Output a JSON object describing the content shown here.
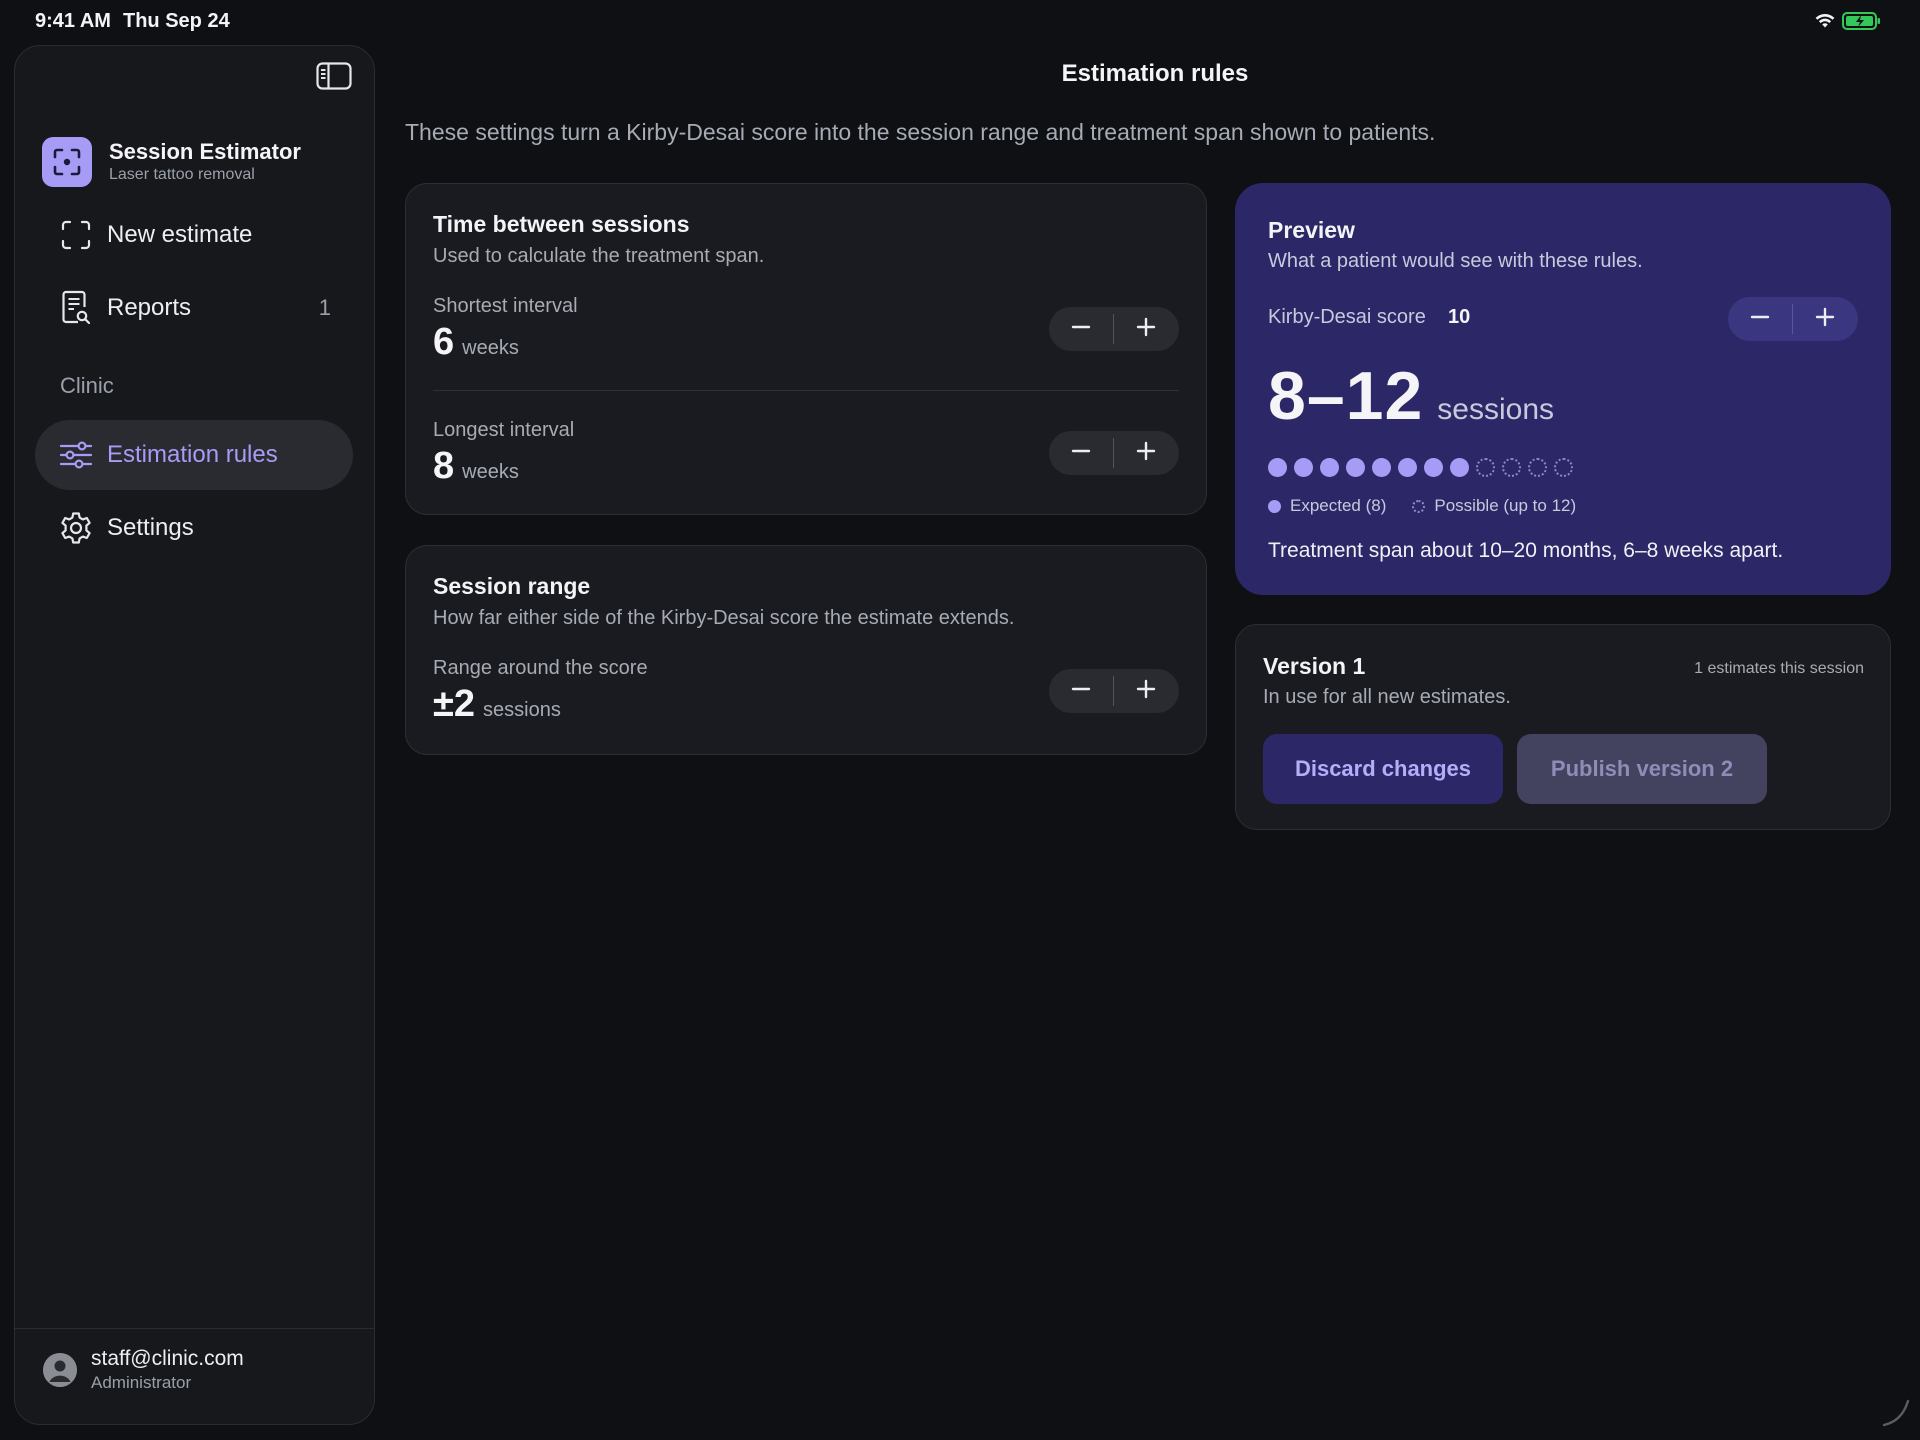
{
  "status_bar": {
    "time": "9:41 AM",
    "date": "Thu Sep 24"
  },
  "app": {
    "name": "Session Estimator",
    "subtitle": "Laser tattoo removal"
  },
  "sidebar": {
    "items": [
      {
        "label": "New estimate",
        "icon": "scan-icon"
      },
      {
        "label": "Reports",
        "icon": "report-search-icon",
        "count": "1"
      }
    ],
    "section_label": "Clinic",
    "section_items": [
      {
        "label": "Estimation rules",
        "icon": "sliders-icon",
        "active": true
      },
      {
        "label": "Settings",
        "icon": "gear-icon"
      }
    ],
    "account": {
      "email": "staff@clinic.com",
      "role": "Administrator"
    }
  },
  "page": {
    "title": "Estimation rules",
    "description": "These settings turn a Kirby-Desai score into the session range and treatment span shown to patients."
  },
  "time_between": {
    "title": "Time between sessions",
    "subtitle": "Used to calculate the treatment span.",
    "shortest": {
      "label": "Shortest interval",
      "value": "6",
      "unit": "weeks"
    },
    "longest": {
      "label": "Longest interval",
      "value": "8",
      "unit": "weeks"
    }
  },
  "session_range": {
    "title": "Session range",
    "subtitle": "How far either side of the Kirby-Desai score the estimate extends.",
    "label": "Range around the score",
    "value": "±2",
    "unit": "sessions"
  },
  "preview": {
    "title": "Preview",
    "subtitle": "What a patient would see with these rules.",
    "score_label": "Kirby-Desai score",
    "score_value": "10",
    "range": "8–12",
    "range_unit": "sessions",
    "expected_sessions": 8,
    "possible_sessions": 12,
    "legend_expected": "Expected (8)",
    "legend_possible": "Possible (up to 12)",
    "span_text": "Treatment span about 10–20 months, 6–8 weeks apart."
  },
  "version": {
    "title": "Version 1",
    "subtitle": "In use for all new estimates.",
    "count_text": "1 estimates this session",
    "discard_label": "Discard changes",
    "publish_label": "Publish version 2"
  },
  "colors": {
    "accent": "#a79cf5",
    "background": "#0e1014",
    "card": "#1a1b20",
    "preview_card": "#2c2868",
    "battery": "#34c759"
  }
}
